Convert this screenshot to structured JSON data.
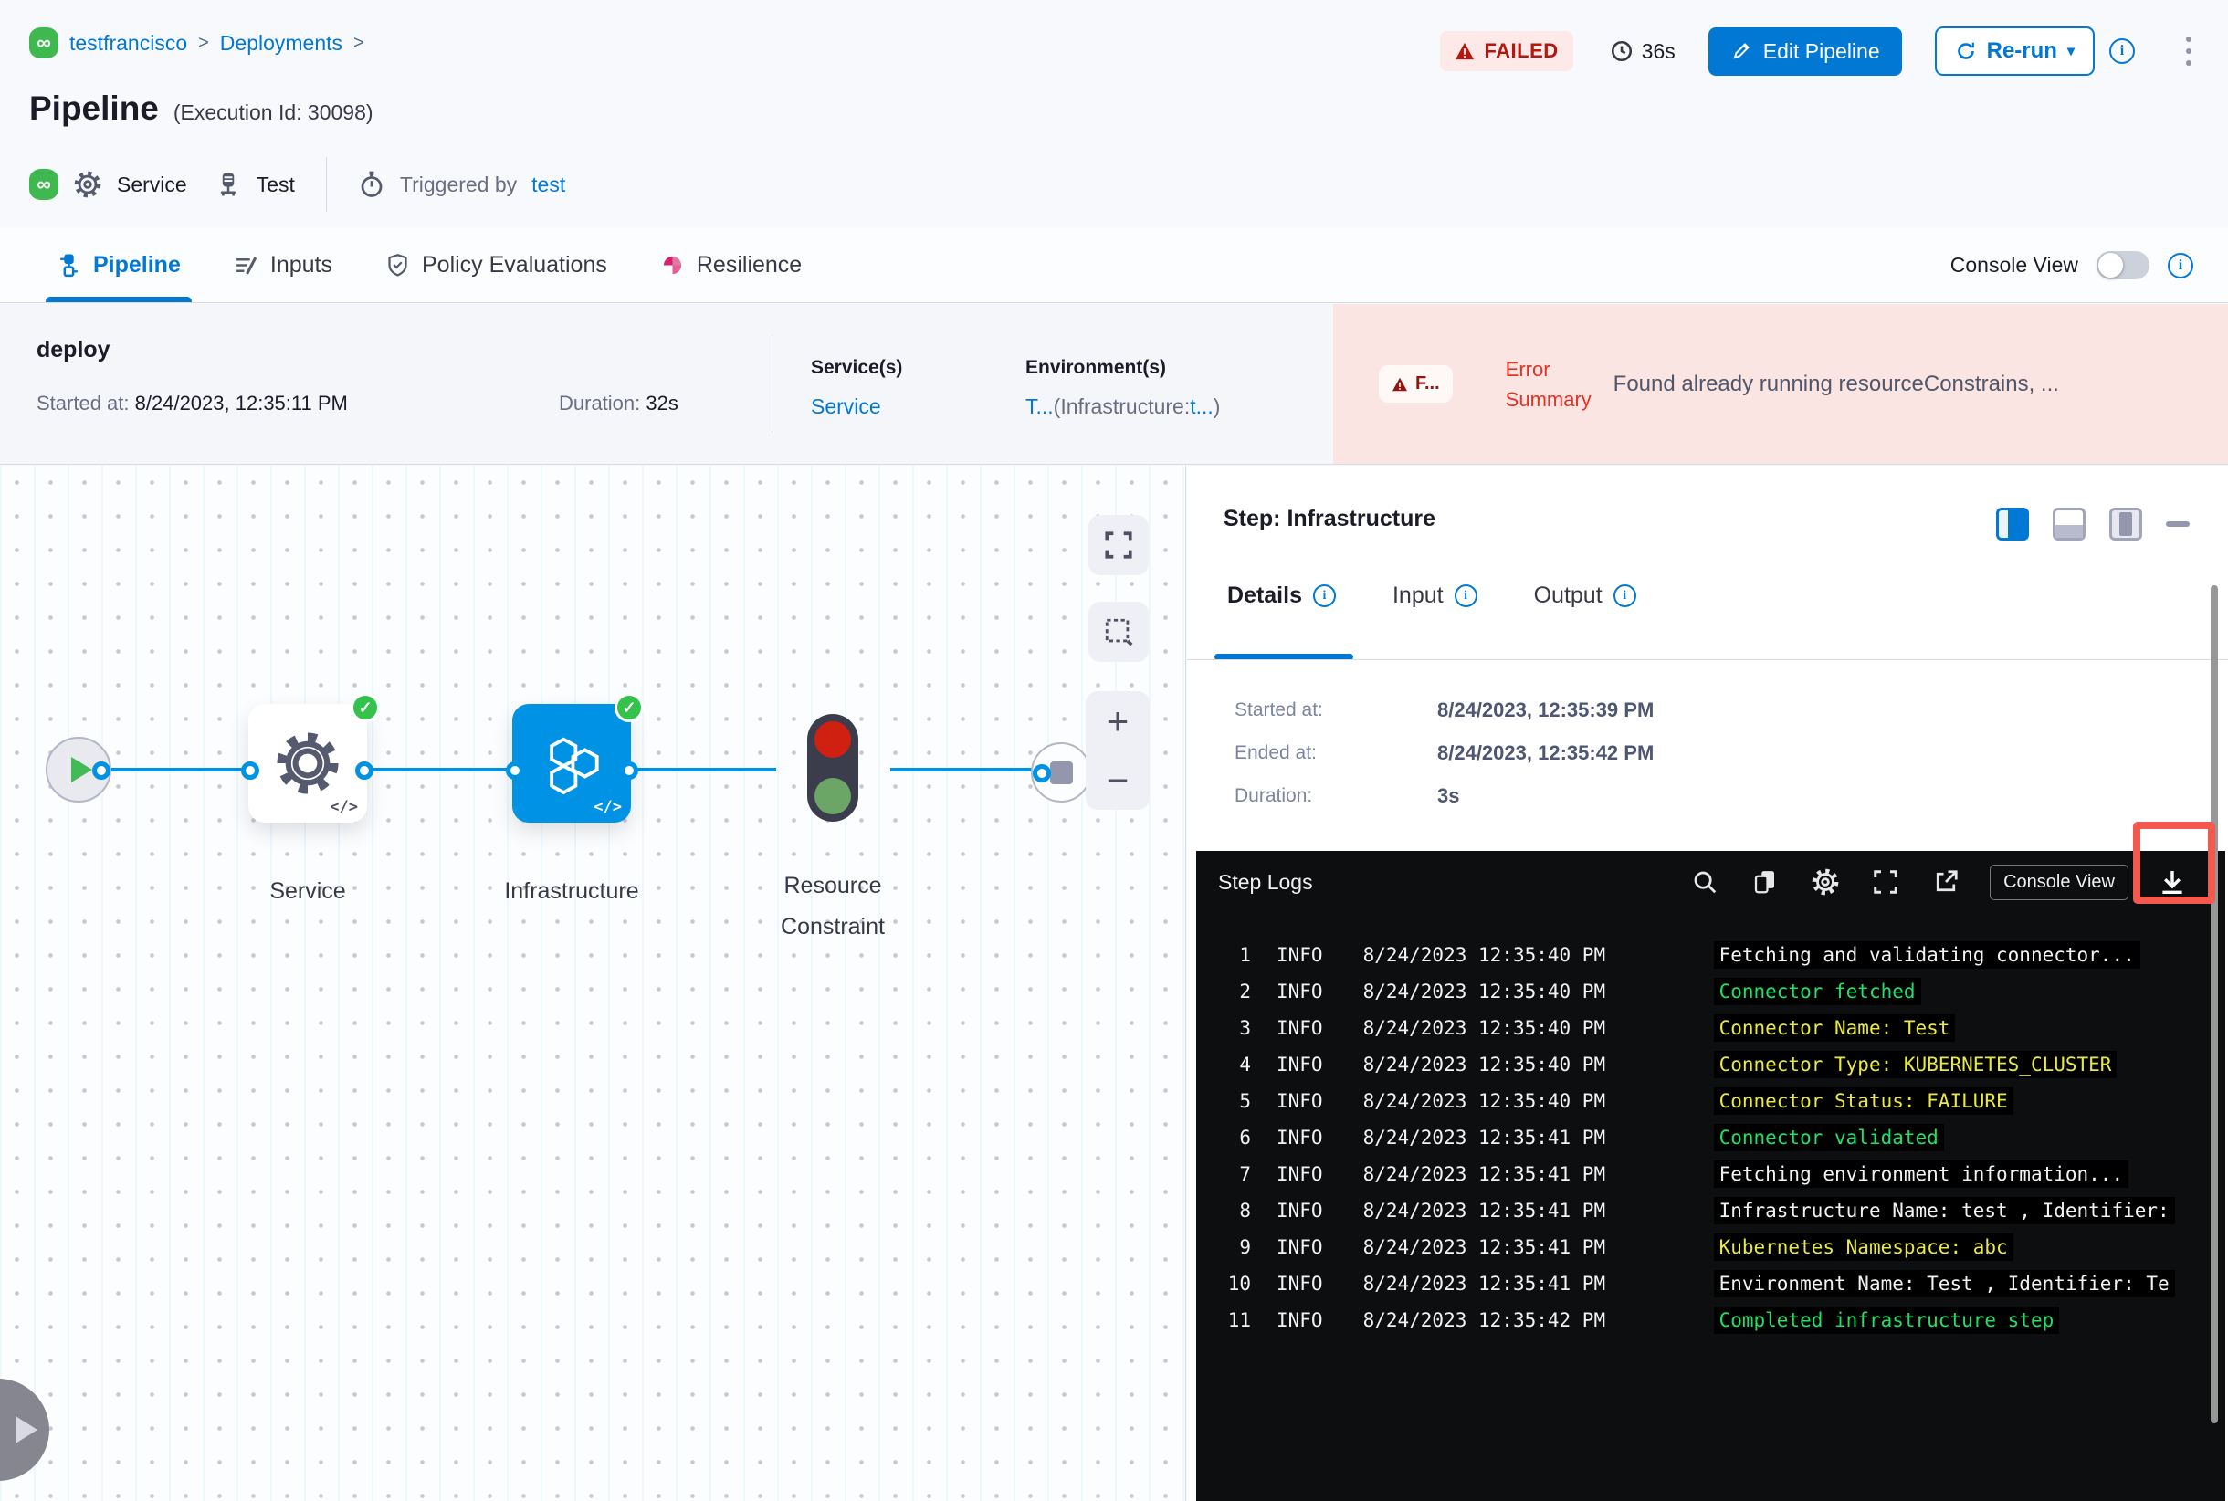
{
  "colors": {
    "accent": "#0278d5",
    "node_blue": "#0092e4",
    "failed_red": "#b41710",
    "error_bg": "#fbe5e3",
    "success_green": "#35c24c",
    "log_green": "#21e065",
    "log_yellow": "#e9e943",
    "highlight_red": "#f4594e"
  },
  "header": {
    "breadcrumb": {
      "item1": "testfrancisco",
      "item2": "Deployments",
      "separator": ">"
    },
    "title": "Pipeline",
    "execution_id": "(Execution Id: 30098)",
    "meta": {
      "service": "Service",
      "test": "Test",
      "triggered_by": "Triggered by",
      "trigger_user": "test"
    },
    "status": "FAILED",
    "total_duration": "36s",
    "edit_pipeline": "Edit Pipeline",
    "rerun": "Re-run",
    "rerun_caret": "▾"
  },
  "tabs": {
    "pipeline": "Pipeline",
    "inputs": "Inputs",
    "policy": "Policy Evaluations",
    "resilience": "Resilience",
    "console_view": "Console View"
  },
  "stage": {
    "name": "deploy",
    "started_label": "Started at:",
    "started_value": "8/24/2023, 12:35:11 PM",
    "duration_label": "Duration:",
    "duration_value": "32s",
    "services_label": "Service(s)",
    "services_value": "Service",
    "environments_label": "Environment(s)",
    "env_link1": "T...",
    "env_mid": "(Infrastructure:",
    "env_link2": "t...",
    "env_end": ")",
    "error_badge": "F...",
    "error_label": "Error Summary",
    "error_text": "Found already running resourceConstrains, ..."
  },
  "canvas": {
    "node1_label": "Service",
    "node2_label": "Infrastructure",
    "node3_label": "Resource Constraint",
    "code_glyph": "</>",
    "check": "✓",
    "zoom_in": "+",
    "zoom_out": "−"
  },
  "panel": {
    "title": "Step: Infrastructure",
    "tab_details": "Details",
    "tab_input": "Input",
    "tab_output": "Output",
    "details": {
      "started_label": "Started at:",
      "started_value": "8/24/2023, 12:35:39 PM",
      "ended_label": "Ended at:",
      "ended_value": "8/24/2023, 12:35:42 PM",
      "duration_label": "Duration:",
      "duration_value": "3s"
    },
    "logs": {
      "title": "Step Logs",
      "console_view": "Console View",
      "lines": [
        {
          "num": "1",
          "level": "INFO",
          "time": "8/24/2023 12:35:40 PM",
          "msg": "Fetching and validating connector...",
          "color": "white"
        },
        {
          "num": "2",
          "level": "INFO",
          "time": "8/24/2023 12:35:40 PM",
          "msg": "Connector fetched",
          "color": "green"
        },
        {
          "num": "3",
          "level": "INFO",
          "time": "8/24/2023 12:35:40 PM",
          "msg": "Connector Name: Test",
          "color": "yellow"
        },
        {
          "num": "4",
          "level": "INFO",
          "time": "8/24/2023 12:35:40 PM",
          "msg": "Connector Type: KUBERNETES_CLUSTER",
          "color": "yellow"
        },
        {
          "num": "5",
          "level": "INFO",
          "time": "8/24/2023 12:35:40 PM",
          "msg": "Connector Status: FAILURE",
          "color": "yellow"
        },
        {
          "num": "6",
          "level": "INFO",
          "time": "8/24/2023 12:35:41 PM",
          "msg": "Connector validated",
          "color": "green"
        },
        {
          "num": "7",
          "level": "INFO",
          "time": "8/24/2023 12:35:41 PM",
          "msg": "Fetching environment information...",
          "color": "white"
        },
        {
          "num": "8",
          "level": "INFO",
          "time": "8/24/2023 12:35:41 PM",
          "msg": "Infrastructure Name: test , Identifier:",
          "color": "white"
        },
        {
          "num": "9",
          "level": "INFO",
          "time": "8/24/2023 12:35:41 PM",
          "msg": "Kubernetes Namespace: abc",
          "color": "yellow"
        },
        {
          "num": "10",
          "level": "INFO",
          "time": "8/24/2023 12:35:41 PM",
          "msg": "Environment Name: Test , Identifier: Te",
          "color": "white"
        },
        {
          "num": "11",
          "level": "INFO",
          "time": "8/24/2023 12:35:42 PM",
          "msg": "Completed infrastructure step",
          "color": "green"
        }
      ]
    }
  }
}
